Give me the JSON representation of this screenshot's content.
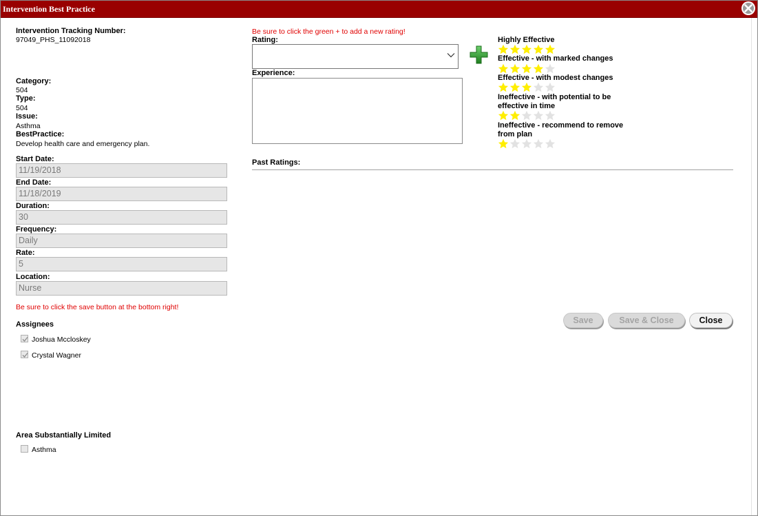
{
  "window": {
    "title": "Intervention Best Practice"
  },
  "left": {
    "tracking_label": "Intervention Tracking Number:",
    "tracking_value": "97049_PHS_11092018",
    "category_label": "Category:",
    "category_value": "504",
    "type_label": "Type:",
    "type_value": "504",
    "issue_label": "Issue:",
    "issue_value": "Asthma",
    "bestpractice_label": "BestPractice:",
    "bestpractice_value": "Develop health care and emergency plan.",
    "fields": {
      "start_label": "Start Date:",
      "start_value": "11/19/2018",
      "end_label": "End Date:",
      "end_value": "11/18/2019",
      "duration_label": "Duration:",
      "duration_value": "30",
      "frequency_label": "Frequency:",
      "frequency_value": "Daily",
      "rate_label": "Rate:",
      "rate_value": "5",
      "location_label": "Location:",
      "location_value": "Nurse"
    },
    "save_note": "Be sure to click the save button at the bottom right!",
    "assignees_label": "Assignees",
    "assignees": [
      {
        "name": "Joshua Mccloskey",
        "checked": true
      },
      {
        "name": "Crystal Wagner",
        "checked": true
      }
    ],
    "area_label": "Area Substantially Limited",
    "area_items": [
      {
        "name": "Asthma",
        "checked": false
      }
    ]
  },
  "rating": {
    "note": "Be sure to click the green + to add a new rating!",
    "rating_label": "Rating:",
    "rating_value": "",
    "experience_label": "Experience:",
    "experience_value": ""
  },
  "legend": [
    {
      "label": "Highly Effective",
      "stars": 5
    },
    {
      "label": "Effective - with marked changes",
      "stars": 4
    },
    {
      "label": "Effective - with modest changes",
      "stars": 3
    },
    {
      "label": "Ineffective - with potential to be effective in time",
      "stars": 2
    },
    {
      "label": "Ineffective - recommend to remove from plan",
      "stars": 1
    }
  ],
  "past_ratings_label": "Past Ratings:",
  "buttons": {
    "save": "Save",
    "save_close": "Save & Close",
    "close": "Close"
  },
  "colors": {
    "titlebar": "#990000",
    "star_on": "#ffee00",
    "star_off": "#e2e2e2",
    "plus": "#2e9a2e",
    "note_red": "#e00000"
  },
  "icons": {
    "close": "close-icon",
    "dropdown": "chevron-down-icon",
    "add": "plus-icon",
    "star": "star-icon",
    "check": "check-icon"
  }
}
